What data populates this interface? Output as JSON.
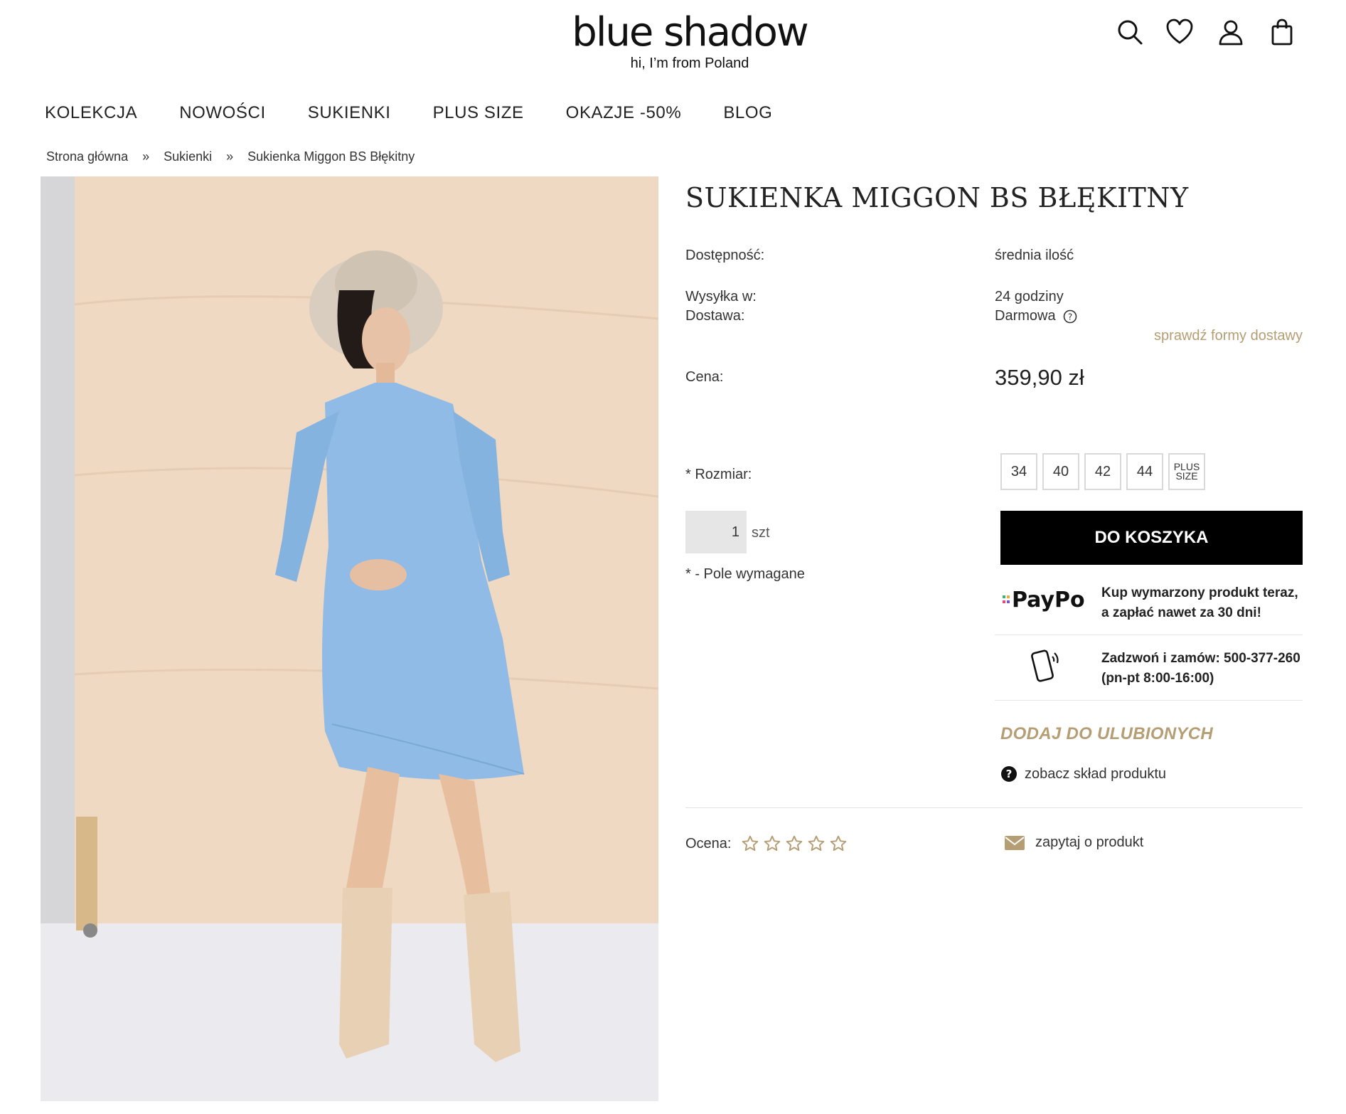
{
  "header": {
    "logo": "blue shadow",
    "tagline": "hi, I’m from Poland",
    "icons": [
      "search-icon",
      "heart-icon",
      "user-icon",
      "bag-icon"
    ]
  },
  "nav": {
    "items": [
      "KOLEKCJA",
      "NOWOŚCI",
      "SUKIENKI",
      "PLUS SIZE",
      "OKAZJE -50%",
      "BLOG"
    ]
  },
  "breadcrumb": {
    "items": [
      "Strona główna",
      "Sukienki",
      "Sukienka Miggon BS Błękitny"
    ],
    "separator": "»"
  },
  "product": {
    "title": "SUKIENKA MIGGON BS BŁĘKITNY",
    "availability_label": "Dostępność:",
    "availability_value": "średnia ilość",
    "shipping_label": "Wysyłka w:",
    "shipping_value": "24 godziny",
    "delivery_label": "Dostawa:",
    "delivery_value": "Darmowa",
    "delivery_link": "sprawdź formy dostawy",
    "price_label": "Cena:",
    "price": "359,90 zł",
    "size_label": "* Rozmiar:",
    "sizes": [
      "34",
      "40",
      "42",
      "44"
    ],
    "size_plus_line1": "PLUS",
    "size_plus_line2": "SIZE",
    "quantity": "1",
    "quantity_unit": "szt",
    "required_note": "* - Pole wymagane",
    "cart_button": "DO KOSZYKA",
    "paypo_logo": "PayPo",
    "paypo_text_1": "Kup wymarzony produkt teraz,",
    "paypo_text_2": "a zapłać nawet za 30 dni!",
    "phone_text_1": "Zadzwoń i zamów: 500-377-260",
    "phone_text_2": "(pn-pt 8:00-16:00)",
    "favorites": "DODAJ DO ULUBIONYCH",
    "composition": "zobacz skład produktu",
    "rating_label": "Ocena:",
    "rating_stars": 5,
    "ask": "zapytaj o produkt"
  },
  "colors": {
    "accent_gold": "#b59d74",
    "button_black": "#000000",
    "dress_blue": "#8fbbe6",
    "background_wood": "#eddac6"
  }
}
